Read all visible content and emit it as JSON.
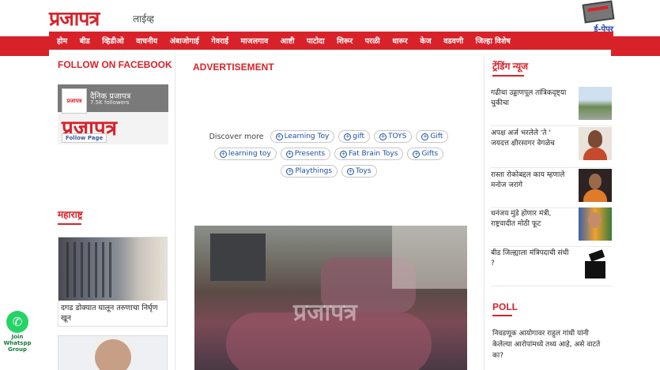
{
  "header": {
    "logo": "प्रजापत्र",
    "logo_sub": "लाईव्ह",
    "epaper_label": "ई-पेपर"
  },
  "nav": {
    "items": [
      "होम",
      "बीड",
      "व्हिडीओ",
      "वाचनीय",
      "अंबाजोगाई",
      "गेवराई",
      "माजलगाव",
      "आष्टी",
      "पाटोदा",
      "शिरूर",
      "परळी",
      "धारूर",
      "केज",
      "वडवणी",
      "जिल्हा विशेष"
    ]
  },
  "left": {
    "facebook_title": "FOLLOW ON FACEBOOK",
    "fb_page_name": "दैनिक प्रजापत्र",
    "fb_followers": "7.5K followers",
    "fb_big_text": "प्रजापत्र",
    "fb_thumb_text": "प्रजापत्र",
    "fb_follow_button": "Follow Page",
    "maharashtra_title": "महाराष्ट्र",
    "maharashtra_card_text": "दगड डोक्यात घालून तरुणाचा निर्घृण खून"
  },
  "whatsapp": {
    "label": "Join Whatspp Group",
    "icon": "whatsapp-icon"
  },
  "middle": {
    "ad_title": "ADVERTISEMENT",
    "discover_label": "Discover more",
    "chips": [
      "Learning Toy",
      "gift",
      "TOYS",
      "Gift",
      "learning toy",
      "Presents",
      "Fat Brain Toys",
      "Gifts",
      "Playthings",
      "Toys"
    ],
    "photo_watermark": "प्रजापत्र"
  },
  "right": {
    "trending_title": "ट्रेंडिंग न्यूज",
    "trending": [
      {
        "text": "गढीचा उड्डाणपूल तांत्रिकदृष्ट्या चुकीचा"
      },
      {
        "text": "अपक्ष अर्ज भरलेले 'ते ' जयदत्त क्षीरसागर वेगळेच"
      },
      {
        "text": "रास्ता रोकोबद्दल काय म्हणाले मनोज जरांगे"
      },
      {
        "text": "धनंजय मुंडे होणार मंत्री, राष्ट्रवादीत मोठी फूट"
      },
      {
        "text": "बीड जिल्ह्याला मंत्रिपदाची संधी ?"
      }
    ],
    "poll_title": "POLL",
    "poll_text": "निवडणूक आयोगावर राहुल गांधी यांनी केलेल्या आरोपांमध्ये तथ्य आहे, असे वाटते का?"
  },
  "colors": {
    "brand_red": "#d8222a",
    "link_blue": "#1a4fa0"
  }
}
